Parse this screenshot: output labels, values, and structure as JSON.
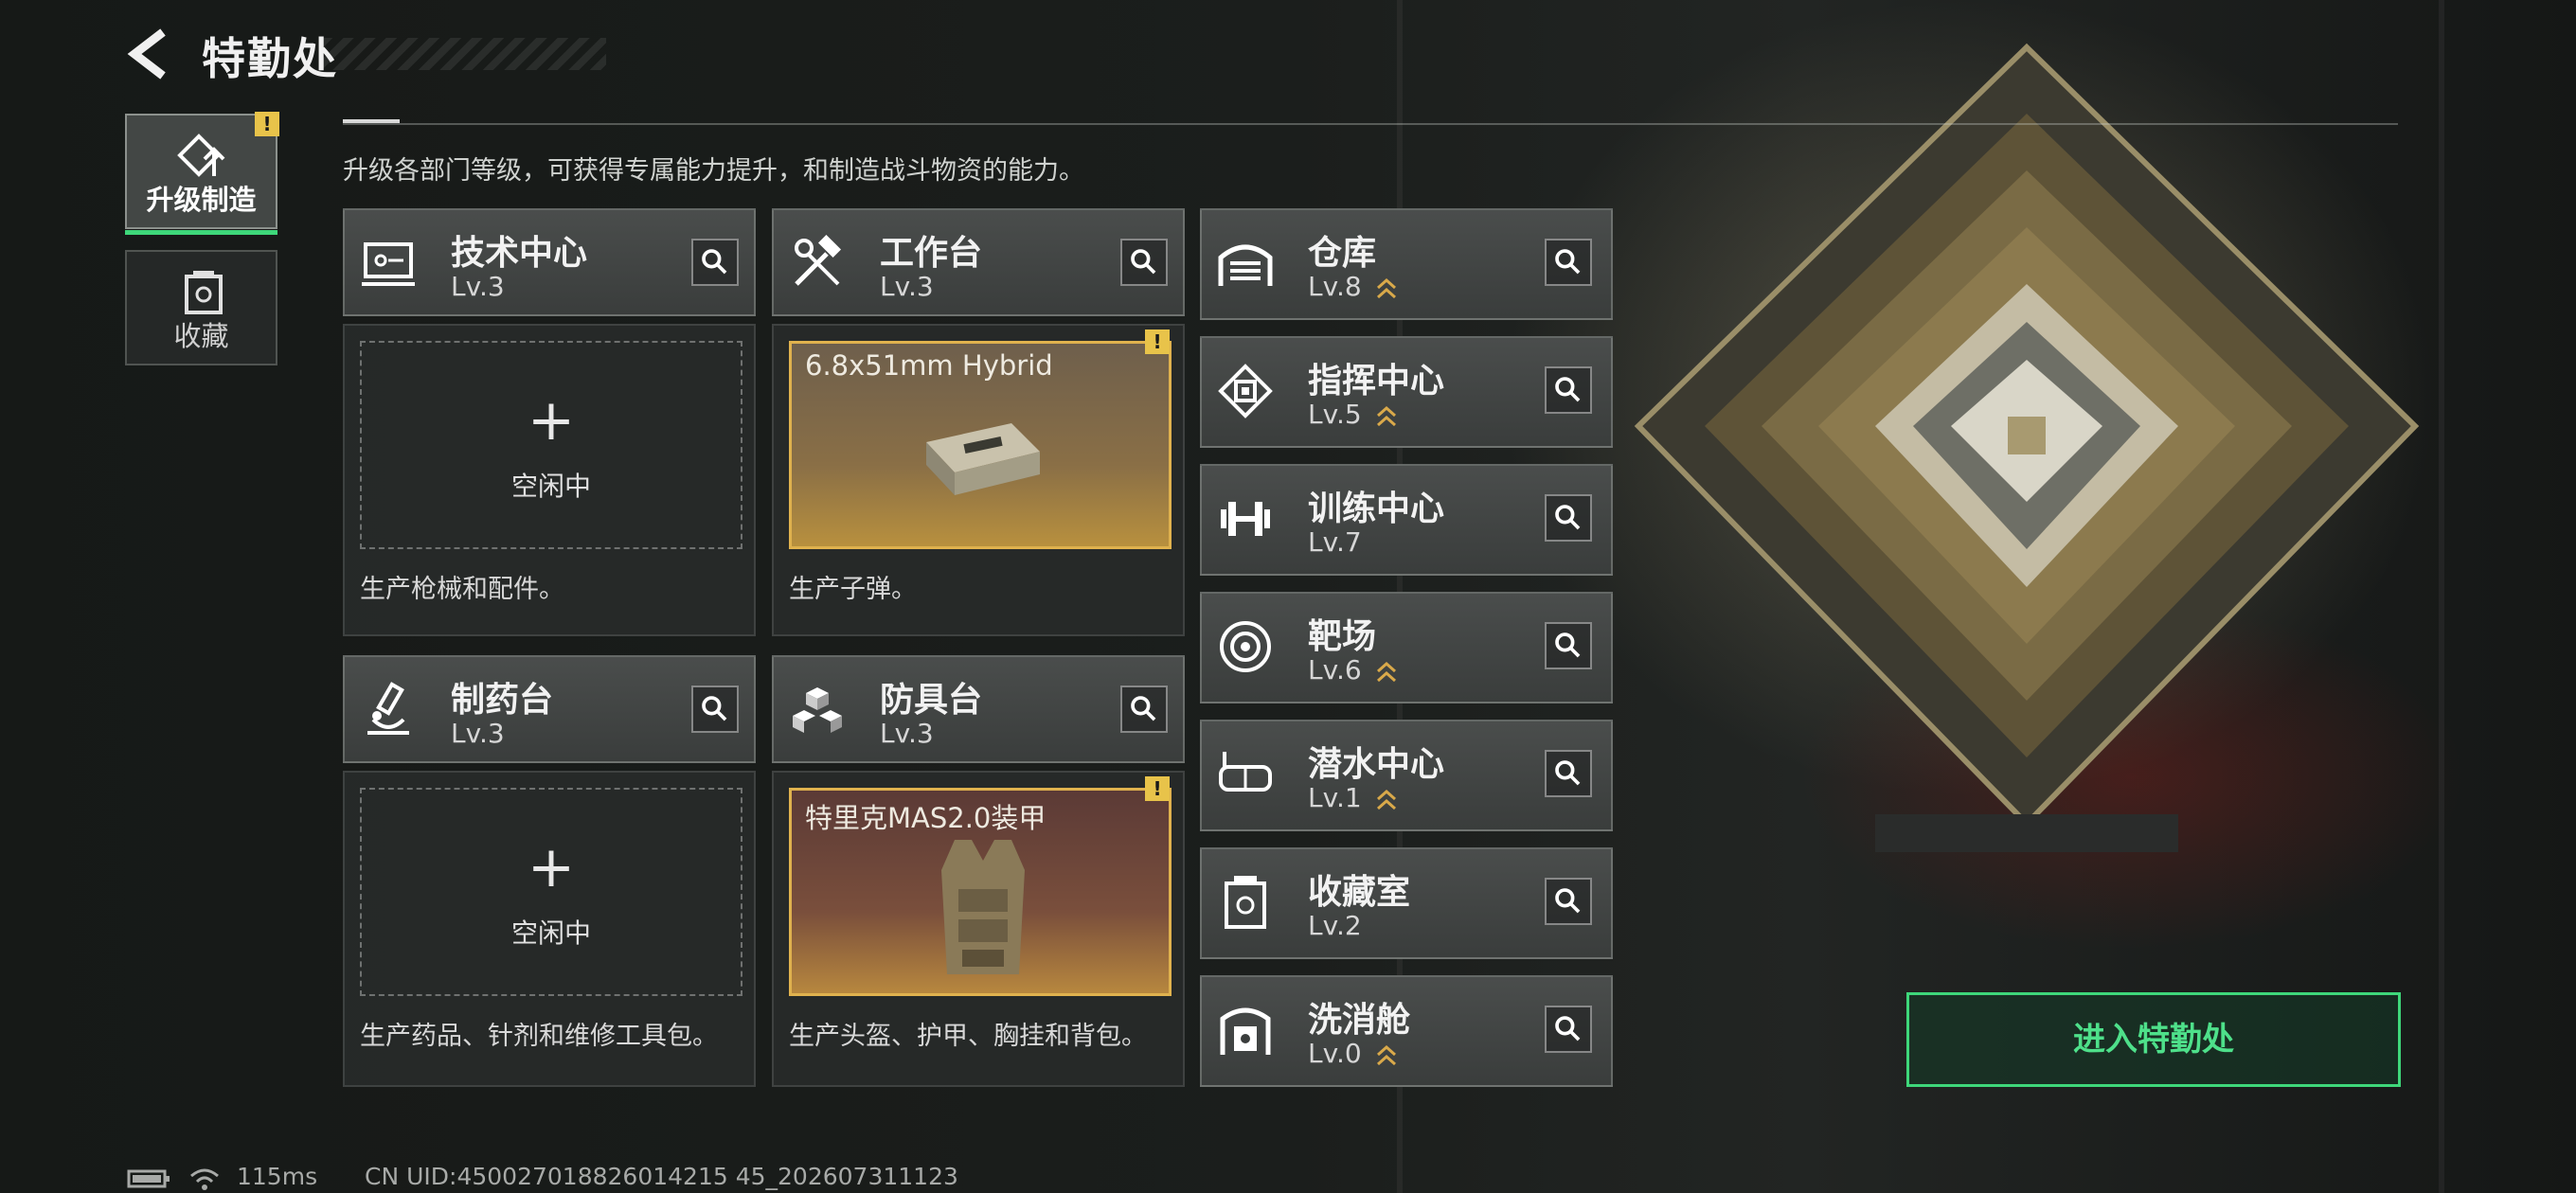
{
  "header": {
    "title": "特勤处",
    "description": "升级各部门等级，可获得专属能力提升，和制造战斗物资的能力。"
  },
  "sidebar": {
    "tabs": [
      {
        "label": "升级制造",
        "icon": "upgrade-build-icon",
        "active": true,
        "alert": "!"
      },
      {
        "label": "收藏",
        "icon": "collection-icon",
        "active": false
      }
    ]
  },
  "workstations": [
    {
      "name": "技术中心",
      "level": "Lv.3",
      "icon": "tech-center-icon",
      "status": "空闲中",
      "description": "生产枪械和配件。"
    },
    {
      "name": "工作台",
      "level": "Lv.3",
      "icon": "workbench-tools-icon",
      "producing": "6.8x51mm Hybrid",
      "alert": "!",
      "description": "生产子弹。"
    },
    {
      "name": "制药台",
      "level": "Lv.3",
      "icon": "microscope-icon",
      "status": "空闲中",
      "description": "生产药品、针剂和维修工具包。"
    },
    {
      "name": "防具台",
      "level": "Lv.3",
      "icon": "armor-cubes-icon",
      "producing": "特里克MAS2.0装甲",
      "alert": "!",
      "description": "生产头盔、护甲、胸挂和背包。"
    }
  ],
  "departments": [
    {
      "name": "仓库",
      "level": "Lv.8",
      "icon": "warehouse-icon"
    },
    {
      "name": "指挥中心",
      "level": "Lv.5",
      "icon": "command-chip-icon"
    },
    {
      "name": "训练中心",
      "level": "Lv.7",
      "icon": "dumbbell-icon"
    },
    {
      "name": "靶场",
      "level": "Lv.6",
      "icon": "target-icon"
    },
    {
      "name": "潜水中心",
      "level": "Lv.1",
      "icon": "diving-mask-icon"
    },
    {
      "name": "收藏室",
      "level": "Lv.2",
      "icon": "collection-room-icon"
    },
    {
      "name": "洗消舱",
      "level": "Lv.0",
      "icon": "decontamination-icon"
    }
  ],
  "enter_button": "进入特勤处",
  "status_bar": {
    "ping": "115ms",
    "uid": "CN UID:450027018826014215 45_202607311123"
  },
  "colors": {
    "accent_green": "#3ed77a",
    "alert_yellow": "#e8c34a",
    "production_gold": "#e0b24e"
  }
}
